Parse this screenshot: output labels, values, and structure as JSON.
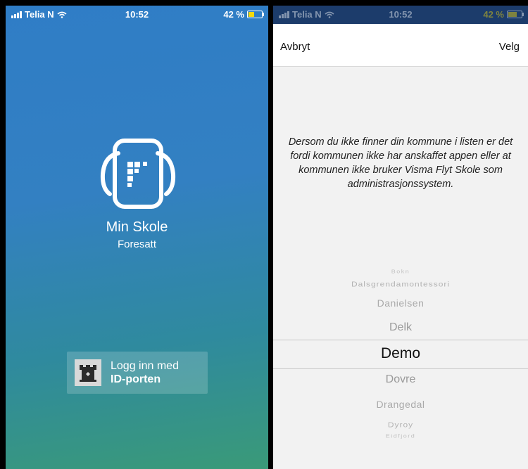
{
  "status_bar": {
    "carrier": "Telia N",
    "time": "10:52",
    "battery": "42 %"
  },
  "login_screen": {
    "app_name": "Min Skole",
    "role": "Foresatt",
    "login_button": {
      "line1": "Logg inn med",
      "line2": "ID-porten"
    },
    "icons": [
      "backpack-logo-icon",
      "id-porten-icon"
    ]
  },
  "picker_screen": {
    "cancel_label": "Avbryt",
    "select_label": "Velg",
    "info_text": "Dersom du ikke finner din kommune i listen er det fordi kommunen ikke har anskaffet appen eller at kommunen ikke bruker Visma Flyt Skole som administrasjonssystem.",
    "options": [
      "Bokn",
      "Dalsgrendamontessori",
      "Danielsen",
      "Delk",
      "Demo",
      "Dovre",
      "Drangedal",
      "Dyroy",
      "Eidfjord"
    ],
    "selected": "Demo"
  },
  "colors": {
    "gradient_top": "#2f7dc6",
    "gradient_bottom": "#3a9a78",
    "status_bar_right": "#1c3c6b",
    "battery_fill": "#f5d90a"
  }
}
